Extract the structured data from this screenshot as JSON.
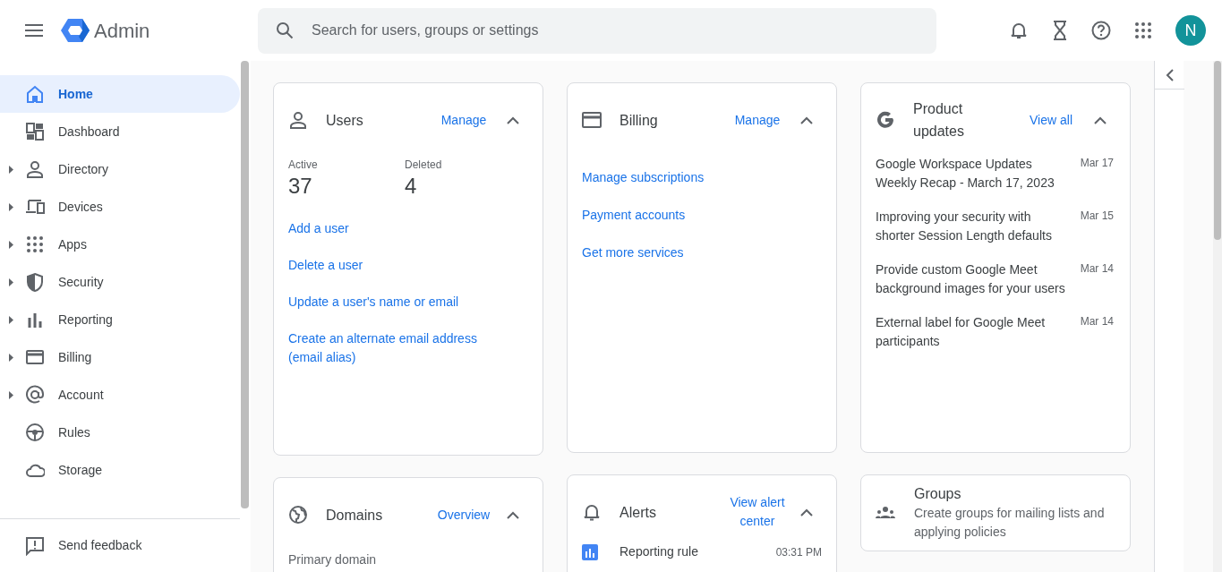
{
  "header": {
    "app_name": "Admin",
    "search": {
      "placeholder": "Search for users, groups or settings"
    },
    "avatar": "N"
  },
  "sidebar": {
    "items": [
      {
        "kind": "home",
        "label": "Home",
        "selected": true,
        "expandable": false
      },
      {
        "kind": "dashboard",
        "label": "Dashboard",
        "selected": false,
        "expandable": false
      },
      {
        "kind": "directory",
        "label": "Directory",
        "selected": false,
        "expandable": true
      },
      {
        "kind": "devices",
        "label": "Devices",
        "selected": false,
        "expandable": true
      },
      {
        "kind": "apps",
        "label": "Apps",
        "selected": false,
        "expandable": true
      },
      {
        "kind": "security",
        "label": "Security",
        "selected": false,
        "expandable": true
      },
      {
        "kind": "reporting",
        "label": "Reporting",
        "selected": false,
        "expandable": true
      },
      {
        "kind": "billing",
        "label": "Billing",
        "selected": false,
        "expandable": true
      },
      {
        "kind": "account",
        "label": "Account",
        "selected": false,
        "expandable": true
      },
      {
        "kind": "rules",
        "label": "Rules",
        "selected": false,
        "expandable": false
      },
      {
        "kind": "storage",
        "label": "Storage",
        "selected": false,
        "expandable": false
      }
    ],
    "feedback": "Send feedback"
  },
  "columns": [
    [
      {
        "kind": "users",
        "title": "Users",
        "action": "Manage",
        "expanded": true,
        "stats": [
          {
            "label": "Active",
            "value": "37"
          },
          {
            "label": "Deleted",
            "value": "4"
          }
        ],
        "links": [
          "Add a user",
          "Delete a user",
          "Update a user's name or email",
          "Create an alternate email address (email alias)"
        ]
      },
      {
        "kind": "domains",
        "title": "Domains",
        "action": "Overview",
        "expanded": true,
        "field_label": "Primary domain"
      }
    ],
    [
      {
        "kind": "billing",
        "title": "Billing",
        "action": "Manage",
        "expanded": true,
        "links": [
          "Manage subscriptions",
          "Payment accounts",
          "Get more services"
        ]
      },
      {
        "kind": "alerts",
        "title": "Alerts",
        "action": "View alert center",
        "expanded": true,
        "items": [
          {
            "title": "Reporting rule",
            "time": "03:31 PM"
          }
        ]
      }
    ],
    [
      {
        "kind": "updates",
        "title": "Product updates",
        "action": "View all",
        "expanded": true,
        "updates": [
          {
            "text": "Google Workspace Updates Weekly Recap - March 17, 2023",
            "date": "Mar 17"
          },
          {
            "text": "Improving your security with shorter Session Length defaults",
            "date": "Mar 15"
          },
          {
            "text": "Provide custom Google Meet background images for your users",
            "date": "Mar 14"
          },
          {
            "text": "External label for Google Meet participants",
            "date": "Mar 14"
          }
        ]
      },
      {
        "kind": "groups",
        "title": "Groups",
        "description": "Create groups for mailing lists and applying policies"
      }
    ]
  ]
}
